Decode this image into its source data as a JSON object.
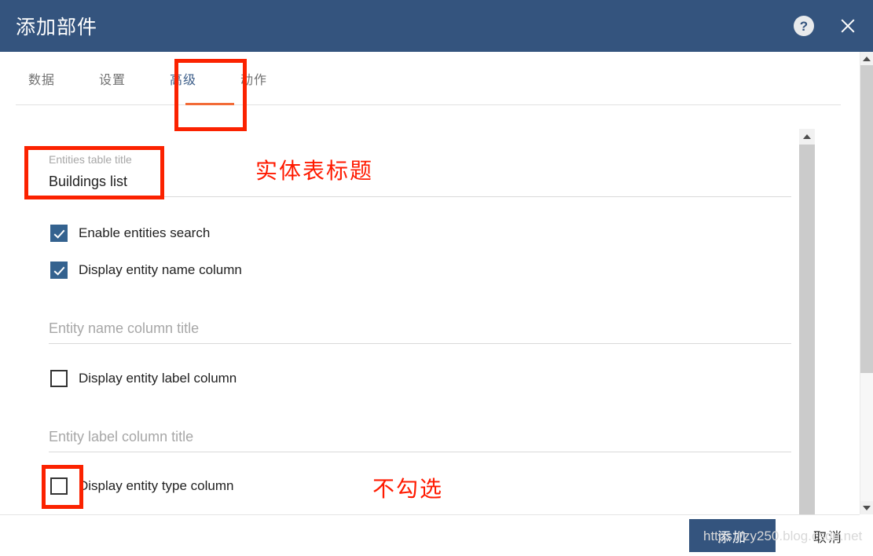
{
  "header": {
    "title": "添加部件",
    "help_icon": "help-icon",
    "close_icon": "close-icon"
  },
  "tabs": [
    {
      "label": "数据",
      "active": false
    },
    {
      "label": "设置",
      "active": false
    },
    {
      "label": "高级",
      "active": true
    },
    {
      "label": "动作",
      "active": false
    }
  ],
  "form": {
    "entities_table_title": {
      "label": "Entities table title",
      "value": "Buildings list"
    },
    "enable_entities_search": {
      "label": "Enable entities search",
      "checked": true
    },
    "display_entity_name_column": {
      "label": "Display entity name column",
      "checked": true
    },
    "entity_name_column_title": {
      "placeholder": "Entity name column title",
      "value": ""
    },
    "display_entity_label_column": {
      "label": "Display entity label column",
      "checked": false
    },
    "entity_label_column_title": {
      "placeholder": "Entity label column title",
      "value": ""
    },
    "display_entity_type_column": {
      "label": "Display entity type column",
      "checked": false
    }
  },
  "footer": {
    "primary_label": "添加",
    "cancel_label": "取消"
  },
  "annotations": {
    "entities_title_note": "实体表标题",
    "no_check_note": "不勾选"
  },
  "watermark": "https://zy250.blog.csdn.net",
  "colors": {
    "header_blue": "#34547e",
    "accent_orange": "#f26b38",
    "checkbox_blue": "#34628f",
    "annotation_red": "#fb2200"
  }
}
